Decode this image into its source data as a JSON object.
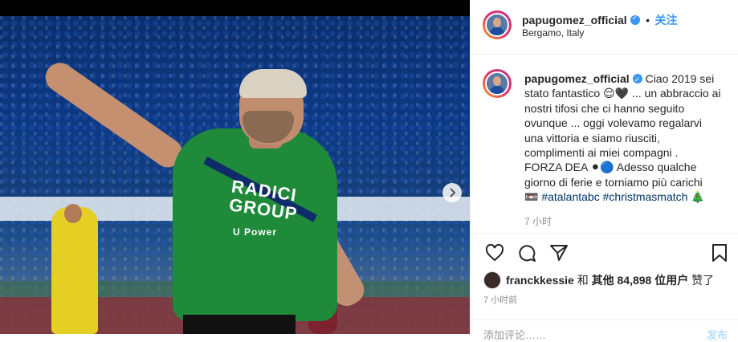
{
  "post": {
    "username": "papugomez_official",
    "follow_label": "关注",
    "separator": "•",
    "location": "Bergamo, Italy",
    "caption_lines": [
      "Ciao 2019 sei",
      "stato fantastico 😌🖤 ... un abbraccio ai",
      "nostri tifosi che ci hanno seguito",
      "ovunque ... oggi volevamo regalarvi",
      "una vittoria e siamo riusciti,",
      "complimenti ai miei compagni .",
      "FORZA DEA ⚫🔵 Adesso qualche",
      "giorno di ferie e torniamo più carichi"
    ],
    "caption_tail_prefix": "📼",
    "hashtag1": "#atalantabc",
    "hashtag2": "#christmasmatch",
    "caption_tail_suffix": "🎄",
    "caption_time": "7 小时",
    "likes_user": "franckkessie",
    "likes_joiner": "和",
    "likes_others_label": "其他",
    "likes_count": "84,898",
    "likes_unit": "位用户",
    "likes_verb": "赞了",
    "time_ago": "7 小时前",
    "comment_placeholder": "添加评论……",
    "post_label": "发布"
  },
  "photo": {
    "jersey_sponsor_line1": "RADICI",
    "jersey_sponsor_line2": "GROUP",
    "jersey_sub": "U Power",
    "carousel_dots": 3,
    "carousel_active": 0
  },
  "icons": {
    "verified": "verified-badge-icon",
    "heart": "heart-icon",
    "comment": "comment-icon",
    "share": "share-icon",
    "bookmark": "bookmark-icon",
    "next": "chevron-right-icon"
  },
  "colors": {
    "link_blue": "#3897f0",
    "hashtag_blue": "#003569",
    "jersey_green": "#1f8a3a"
  }
}
